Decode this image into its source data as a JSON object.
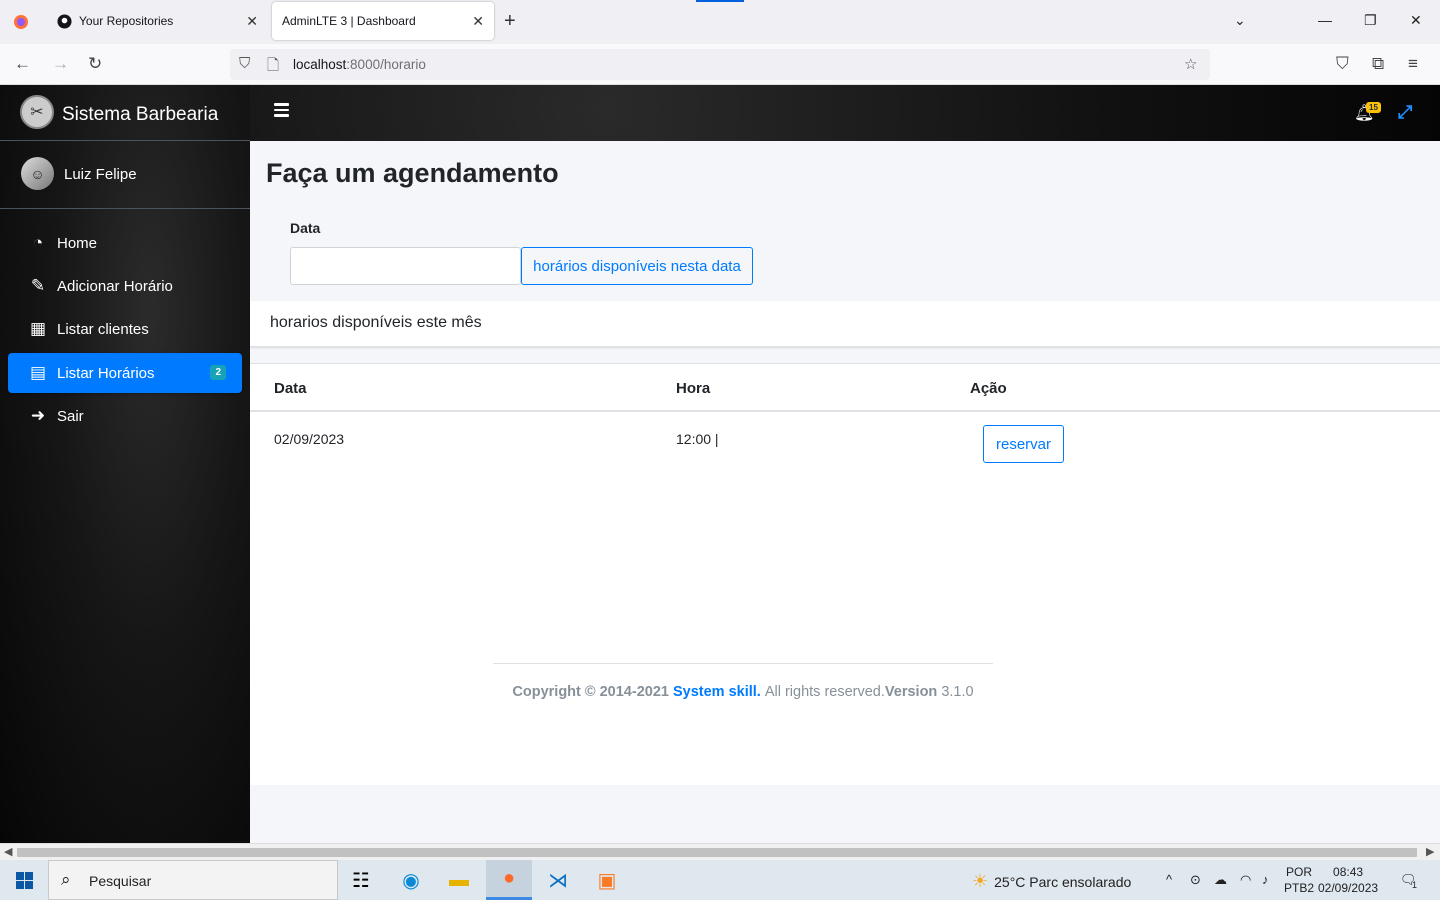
{
  "browser": {
    "tabs": [
      {
        "label": "Your Repositories",
        "icon": "github-icon"
      },
      {
        "label": "AdminLTE 3 | Dashboard",
        "icon": "none"
      }
    ],
    "url_host": "localhost",
    "url_path": ":8000/horario"
  },
  "app": {
    "brand": "Sistema Barbearia",
    "user": "Luiz Felipe",
    "notification_count": "15",
    "menu": [
      {
        "label": "Home",
        "icon": "dashboard-icon"
      },
      {
        "label": "Adicionar Horário",
        "icon": "edit-icon"
      },
      {
        "label": "Listar clientes",
        "icon": "table-icon"
      },
      {
        "label": "Listar Horários",
        "icon": "calendar-icon",
        "active": true,
        "badge": "2"
      },
      {
        "label": "Sair",
        "icon": "sign-out-icon"
      }
    ]
  },
  "page": {
    "title": "Faça um agendamento",
    "date_label": "Data",
    "date_value": "",
    "available_button": "horários disponíveis nesta data",
    "card_title": "horarios disponíveis este mês",
    "table": {
      "headers": [
        "Data",
        "Hora",
        "Ação"
      ],
      "rows": [
        {
          "data": "02/09/2023",
          "hora": "12:00 |",
          "acao": "reservar"
        }
      ]
    }
  },
  "footer": {
    "copyright": "Copyright © 2014-2021",
    "company": "System skill.",
    "rights": "All rights reserved.",
    "version_label": "Version",
    "version": "3.1.0"
  },
  "taskbar": {
    "search_placeholder": "Pesquisar",
    "weather": "25°C  Parc ensolarado",
    "lang_top": "POR",
    "lang_bottom": "PTB2",
    "time": "08:43",
    "date": "02/09/2023",
    "notif_count": "1"
  },
  "colors": {
    "accent": "#007bff",
    "badge_info": "#17a2b8",
    "badge_warning": "#ffc107"
  }
}
